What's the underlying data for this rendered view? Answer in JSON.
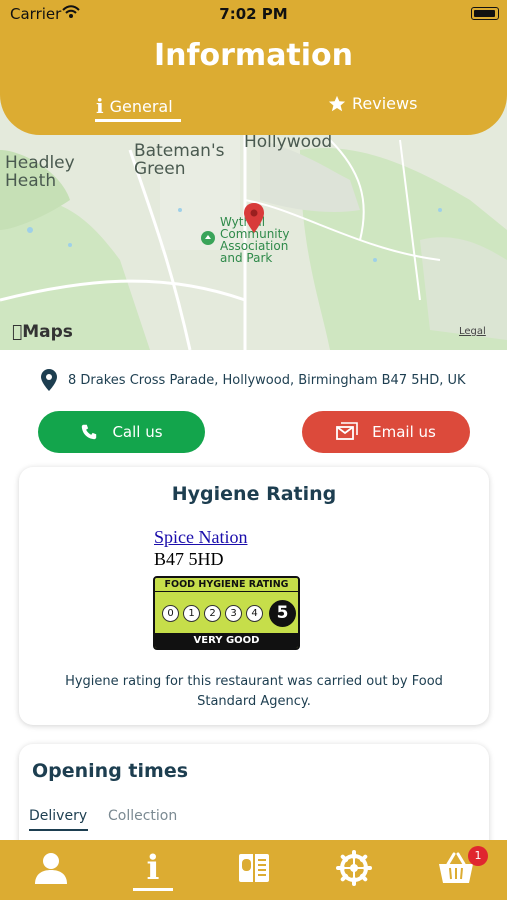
{
  "status_bar": {
    "carrier": "Carrier",
    "time": "7:02 PM"
  },
  "header": {
    "title": "Information",
    "tabs": [
      {
        "label": "General",
        "icon": "info-icon",
        "selected": true
      },
      {
        "label": "Reviews",
        "icon": "star-icon",
        "selected": false
      }
    ]
  },
  "map": {
    "labels": [
      "Hollywood",
      "Headley Heath",
      "Bateman's Green",
      "Wythall Community Association and Park"
    ],
    "logo": "Maps",
    "legal": "Legal"
  },
  "address": {
    "text": "8 Drakes Cross Parade, Hollywood, Birmingham B47 5HD, UK",
    "icon": "location-pin-icon"
  },
  "actions": {
    "call_label": "Call us",
    "email_label": "Email us"
  },
  "hygiene": {
    "title": "Hygiene Rating",
    "business_name": "Spice Nation",
    "postcode": "B47 5HD",
    "badge_header": "FOOD HYGIENE RATING",
    "scale": [
      "0",
      "1",
      "2",
      "3",
      "4"
    ],
    "rating": "5",
    "rating_label": "VERY GOOD",
    "note": "Hygiene rating for this restaurant was carried out by Food Standard Agency."
  },
  "opening": {
    "title": "Opening times",
    "tabs": [
      {
        "label": "Delivery",
        "selected": true
      },
      {
        "label": "Collection",
        "selected": false
      }
    ]
  },
  "bottom_nav": {
    "items": [
      "profile-icon",
      "info-icon",
      "menu-icon",
      "settings-icon",
      "basket-icon"
    ],
    "cart_count": "1"
  },
  "colors": {
    "brand": "#dcac32",
    "call": "#13a54c",
    "email": "#dc4a3b",
    "text": "#1d3e50"
  }
}
